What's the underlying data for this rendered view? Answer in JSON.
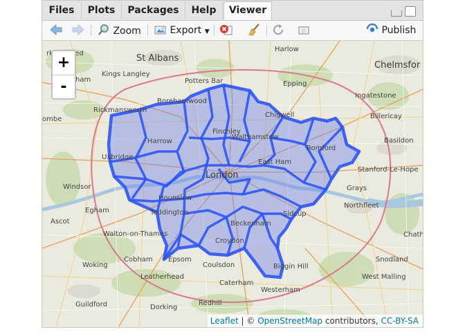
{
  "tabs": [
    {
      "label": "Files",
      "active": false
    },
    {
      "label": "Plots",
      "active": false
    },
    {
      "label": "Packages",
      "active": false
    },
    {
      "label": "Help",
      "active": false
    },
    {
      "label": "Viewer",
      "active": true
    }
  ],
  "toolbar": {
    "zoom_label": "Zoom",
    "export_label": "Export",
    "publish_label": "Publish"
  },
  "map": {
    "zoom_in_label": "+",
    "zoom_out_label": "-",
    "places": [
      {
        "name": "Harlow"
      },
      {
        "name": "St Albans",
        "big": true
      },
      {
        "name": "rkhamsted"
      },
      {
        "name": "Chelmsfor",
        "big": true
      },
      {
        "name": "Kings Langley"
      },
      {
        "name": "Potters Bar"
      },
      {
        "name": "Epping"
      },
      {
        "name": "ham"
      },
      {
        "name": "Borehamwood"
      },
      {
        "name": "Ingatestone"
      },
      {
        "name": "Rickmansworth"
      },
      {
        "name": "Chigwell"
      },
      {
        "name": "Billericay"
      },
      {
        "name": "ombe"
      },
      {
        "name": "Finchley"
      },
      {
        "name": "Walthamstow"
      },
      {
        "name": "Harrow"
      },
      {
        "name": "Romford"
      },
      {
        "name": "Basildon"
      },
      {
        "name": "Uxbridge"
      },
      {
        "name": "East Ham"
      },
      {
        "name": "Stanford-Le-Hope"
      },
      {
        "name": "London",
        "big": true
      },
      {
        "name": "Windsor"
      },
      {
        "name": "Grays"
      },
      {
        "name": "Hounslow"
      },
      {
        "name": "Northfleet"
      },
      {
        "name": "Egham"
      },
      {
        "name": "Teddington"
      },
      {
        "name": "Sidcup"
      },
      {
        "name": "Ascot"
      },
      {
        "name": "Beckenham"
      },
      {
        "name": "Walton-on-Thames"
      },
      {
        "name": "Chath"
      },
      {
        "name": "Croydon"
      },
      {
        "name": "Cobham"
      },
      {
        "name": "Epsom"
      },
      {
        "name": "Snodland"
      },
      {
        "name": "Woking"
      },
      {
        "name": "Coulsdon"
      },
      {
        "name": "Biggin Hill"
      },
      {
        "name": "Leatherhead"
      },
      {
        "name": "West Malling"
      },
      {
        "name": "Caterham"
      },
      {
        "name": "Westerham"
      },
      {
        "name": "Guildford"
      },
      {
        "name": "Dorking"
      },
      {
        "name": "Redhill"
      }
    ],
    "attribution": {
      "leaflet": "Leaflet",
      "sep": " | © ",
      "osm": "OpenStreetMap",
      "contributors": " contributors, ",
      "license": "CC-BY-SA"
    }
  },
  "colors": {
    "boundary": "#3355ff",
    "fill": "#6f7cf0",
    "land": "#eaeadf",
    "link": "#0078a8"
  }
}
